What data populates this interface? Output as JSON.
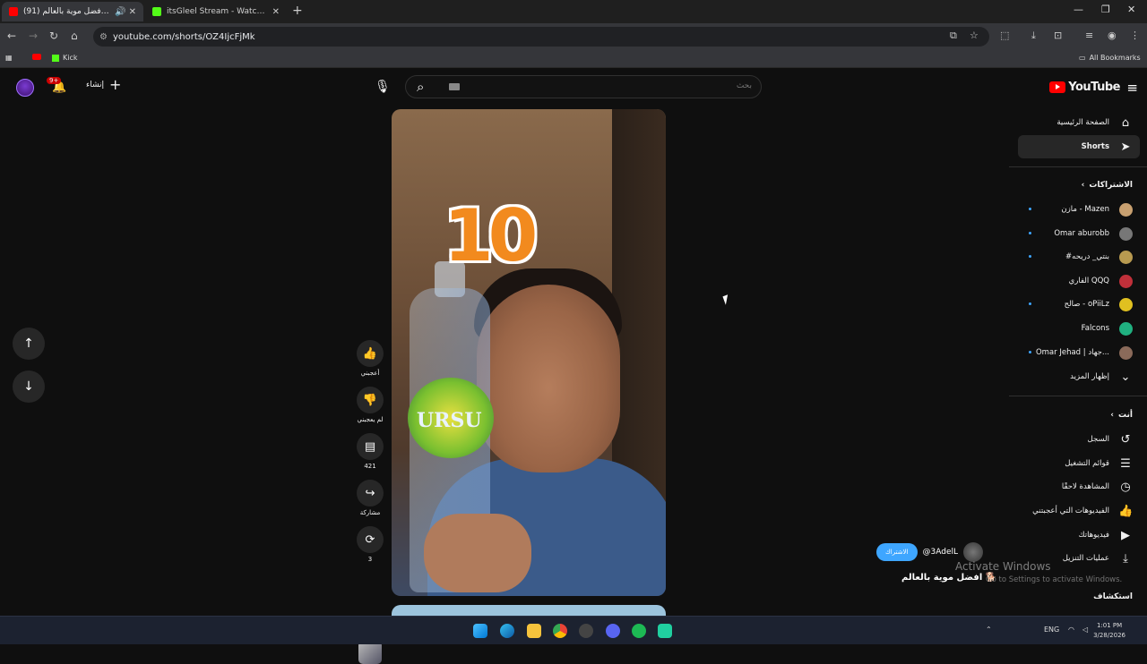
{
  "browser": {
    "tabs": [
      {
        "title": "(91) افضل موية بالعالم 🐕",
        "active": true
      },
      {
        "title": "itsGleel Stream - Watch Live on",
        "active": false
      }
    ],
    "url": "youtube.com/shorts/OZ4IjcFjMk",
    "bookmarks": [
      "Kick"
    ],
    "all_bookmarks": "All Bookmarks"
  },
  "header": {
    "logo_text": "YouTube",
    "search_placeholder": "بحث",
    "create_label": "إنشاء",
    "notif_badge": "9+"
  },
  "sidebar": {
    "home": "الصفحة الرئيسية",
    "shorts": "Shorts",
    "subs_header": "الاشتراكات",
    "subscriptions": [
      "مازن - Mazen",
      "Omar aburobb",
      "#بنتي_ دريحه",
      "الفاري QQQ",
      "صالح - oPiiLz",
      "Falcons",
      "Omar Jehad | جهاد..."
    ],
    "show_more": "إظهار المزيد",
    "you_header": "أنت",
    "you_items": [
      "السجل",
      "قوائم التشغيل",
      "المشاهدة لاحقًا",
      "الفيديوهات التي أعجبتني",
      "فيديوهاتك",
      "عمليات التنزيل"
    ],
    "explore": "استكشاف"
  },
  "short": {
    "overlay_text": "10",
    "bottle_label": "URSU",
    "like_label": "أعجبني",
    "dislike_label": "لم يعجبني",
    "comments_count": "421",
    "share_label": "مشاركة",
    "remix_count": "3",
    "channel": "@3AdelL",
    "subscribe_label": "الاشتراك",
    "title": "افضل موية بالعالم 🐕"
  },
  "windows": {
    "activate_title": "Activate Windows",
    "activate_sub": "Go to Settings to activate Windows.",
    "lang": "ENG",
    "time": "1:01 PM",
    "date": "3/28/2026"
  },
  "colors": {
    "accent_red": "#ff0000",
    "subscribe_blue": "#3ea6ff",
    "price_orange": "#f28a1e"
  }
}
